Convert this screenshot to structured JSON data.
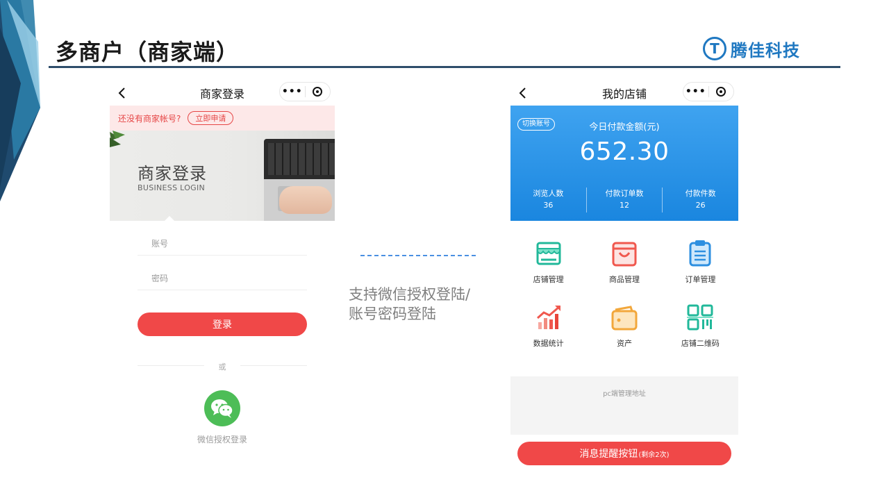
{
  "slide": {
    "title": "多商户（商家端）",
    "logo_text": "腾佳科技",
    "logo_mark": "T"
  },
  "left_phone": {
    "nav_title": "商家登录",
    "nav_back": "‹",
    "capsule_more": "•••",
    "register_text": "还没有商家帐号?",
    "register_button": "立即申请",
    "hero_title": "商家登录",
    "hero_subtitle": "BUSINESS LOGIN",
    "account_placeholder": "账号",
    "password_placeholder": "密码",
    "login_button": "登录",
    "or_text": "或",
    "wechat_label": "微信授权登录"
  },
  "middle": {
    "line1": "支持微信授权登陆/",
    "line2": "账号密码登陆"
  },
  "right_phone": {
    "nav_title": "我的店铺",
    "nav_back": "‹",
    "capsule_more": "•••",
    "switch_account": "切换账号",
    "amount_label": "今日付款金额(元)",
    "amount": "652.30",
    "stats": [
      {
        "label": "浏览人数",
        "value": "36"
      },
      {
        "label": "付款订单数",
        "value": "12"
      },
      {
        "label": "付款件数",
        "value": "26"
      }
    ],
    "menu": [
      {
        "label": "店铺管理",
        "icon": "store-icon"
      },
      {
        "label": "商品管理",
        "icon": "goods-icon"
      },
      {
        "label": "订单管理",
        "icon": "order-icon"
      },
      {
        "label": "数据统计",
        "icon": "stats-chart-icon"
      },
      {
        "label": "资产",
        "icon": "wallet-icon"
      },
      {
        "label": "店铺二维码",
        "icon": "qrcode-icon"
      }
    ],
    "pc_address_label": "pc端管理地址",
    "remind_button": "消息提醒按钮",
    "remind_suffix": "(剩余2次)"
  },
  "colors": {
    "primary_red": "#f04848",
    "card_blue": "#1a86df",
    "wechat_green": "#4dbd57",
    "header_line": "#2e4e6b"
  }
}
